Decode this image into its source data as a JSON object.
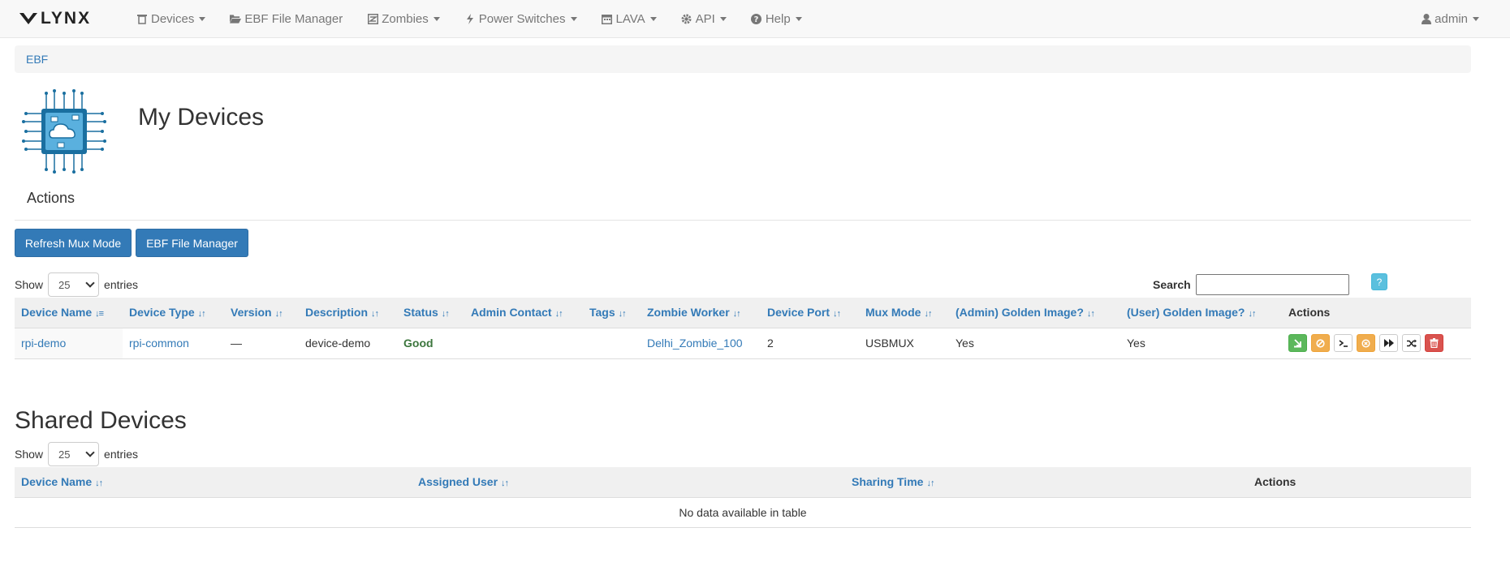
{
  "brand": {
    "name": "LYNX"
  },
  "nav": [
    {
      "label": "Devices",
      "icon": "trash-icon"
    },
    {
      "label": "EBF File Manager",
      "icon": "folder-open-icon"
    },
    {
      "label": "Zombies",
      "icon": "zombie-icon"
    },
    {
      "label": "Power Switches",
      "icon": "bolt-icon"
    },
    {
      "label": "LAVA",
      "icon": "calendar-icon"
    },
    {
      "label": "API",
      "icon": "gear-icon"
    },
    {
      "label": "Help",
      "icon": "question-circle-icon"
    }
  ],
  "user": {
    "label": "admin",
    "icon": "user-icon"
  },
  "breadcrumb": {
    "item": "EBF"
  },
  "page": {
    "title": "My Devices",
    "actions_heading": "Actions"
  },
  "buttons": {
    "refresh_mux": "Refresh Mux Mode",
    "ebf_file_manager": "EBF File Manager"
  },
  "my_devices": {
    "show_label": "Show",
    "entries_label": "entries",
    "page_size": "25",
    "search_label": "Search",
    "search_value": "",
    "help_label": "?",
    "columns": [
      "Device Name",
      "Device Type",
      "Version",
      "Description",
      "Status",
      "Admin Contact",
      "Tags",
      "Zombie Worker",
      "Device Port",
      "Mux Mode",
      "(Admin) Golden Image?",
      "(User) Golden Image?",
      "Actions"
    ],
    "rows": [
      {
        "device_name": "rpi-demo",
        "device_type": "rpi-common",
        "version": "—",
        "description": "device-demo",
        "status": "Good",
        "admin_contact": "",
        "tags": "",
        "zombie_worker": "Delhi_Zombie_100",
        "device_port": "2",
        "mux_mode": "USBMUX",
        "admin_golden": "Yes",
        "user_golden": "Yes"
      }
    ]
  },
  "shared_devices": {
    "title": "Shared Devices",
    "show_label": "Show",
    "entries_label": "entries",
    "page_size": "25",
    "columns": [
      "Device Name",
      "Assigned User",
      "Sharing Time",
      "Actions"
    ],
    "empty_message": "No data available in table"
  },
  "colors": {
    "primary": "#337ab7",
    "success": "#5cb85c",
    "warning": "#f0ad4e",
    "danger": "#d9534f",
    "info": "#5bc0de"
  }
}
